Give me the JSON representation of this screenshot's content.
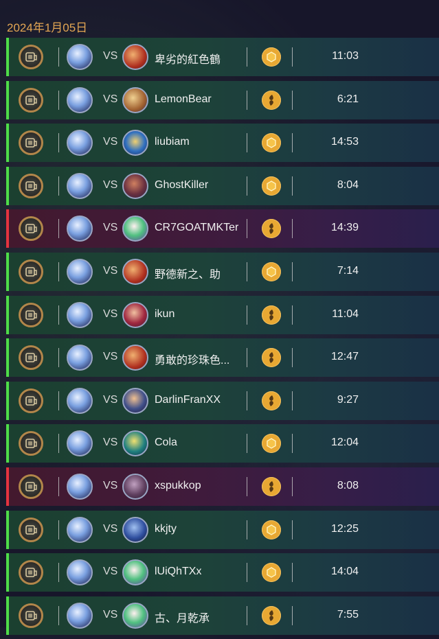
{
  "date_header": "2024年1月05日",
  "colors": {
    "accent_date": "#e3a653",
    "win_bar": "#4fdc49",
    "loss_bar": "#e4333f",
    "mode_icon": "#e8a833"
  },
  "vs_label": "VS",
  "matches": [
    {
      "result": "win",
      "opponent": "卑劣的紅色鶴",
      "opponent_portrait": "red-hero",
      "mode": "standard",
      "mode_icon": "hexagon-coin-icon",
      "duration": "11:03"
    },
    {
      "result": "win",
      "opponent": "LemonBear",
      "opponent_portrait": "bear-hero",
      "mode": "wild",
      "mode_icon": "swirl-coin-icon",
      "duration": "6:21"
    },
    {
      "result": "win",
      "opponent": "liubiam",
      "opponent_portrait": "blue-hero",
      "mode": "standard",
      "mode_icon": "hexagon-coin-icon",
      "duration": "14:53"
    },
    {
      "result": "win",
      "opponent": "GhostKiller",
      "opponent_portrait": "armored-hero",
      "mode": "standard",
      "mode_icon": "hexagon-coin-icon",
      "duration": "8:04"
    },
    {
      "result": "loss",
      "opponent": "CR7GOATMKTer",
      "opponent_portrait": "green-hero",
      "mode": "wild",
      "mode_icon": "swirl-coin-icon",
      "duration": "14:39"
    },
    {
      "result": "win",
      "opponent": "野德新之、助",
      "opponent_portrait": "red-hero",
      "mode": "standard",
      "mode_icon": "hexagon-coin-icon",
      "duration": "7:14"
    },
    {
      "result": "win",
      "opponent": "ikun",
      "opponent_portrait": "crimson-hero",
      "mode": "wild",
      "mode_icon": "swirl-coin-icon",
      "duration": "11:04"
    },
    {
      "result": "win",
      "opponent": "勇敢的珍珠色...",
      "opponent_portrait": "red-hero",
      "mode": "wild",
      "mode_icon": "swirl-coin-icon",
      "duration": "12:47"
    },
    {
      "result": "win",
      "opponent": "DarlinFranXX",
      "opponent_portrait": "warrior-hero",
      "mode": "wild",
      "mode_icon": "swirl-coin-icon",
      "duration": "9:27"
    },
    {
      "result": "win",
      "opponent": "Cola",
      "opponent_portrait": "teal-hero",
      "mode": "standard",
      "mode_icon": "hexagon-coin-icon",
      "duration": "12:04"
    },
    {
      "result": "loss",
      "opponent": "xspukkop",
      "opponent_portrait": "rogue-hero",
      "mode": "wild",
      "mode_icon": "swirl-coin-icon",
      "duration": "8:08"
    },
    {
      "result": "win",
      "opponent": "kkjty",
      "opponent_portrait": "navy-hero",
      "mode": "standard",
      "mode_icon": "hexagon-coin-icon",
      "duration": "12:25"
    },
    {
      "result": "win",
      "opponent": "lUiQhTXx",
      "opponent_portrait": "green-hero",
      "mode": "standard",
      "mode_icon": "hexagon-coin-icon",
      "duration": "14:04"
    },
    {
      "result": "win",
      "opponent": "古、月乾承",
      "opponent_portrait": "green-hero",
      "mode": "wild",
      "mode_icon": "swirl-coin-icon",
      "duration": "7:55"
    }
  ]
}
